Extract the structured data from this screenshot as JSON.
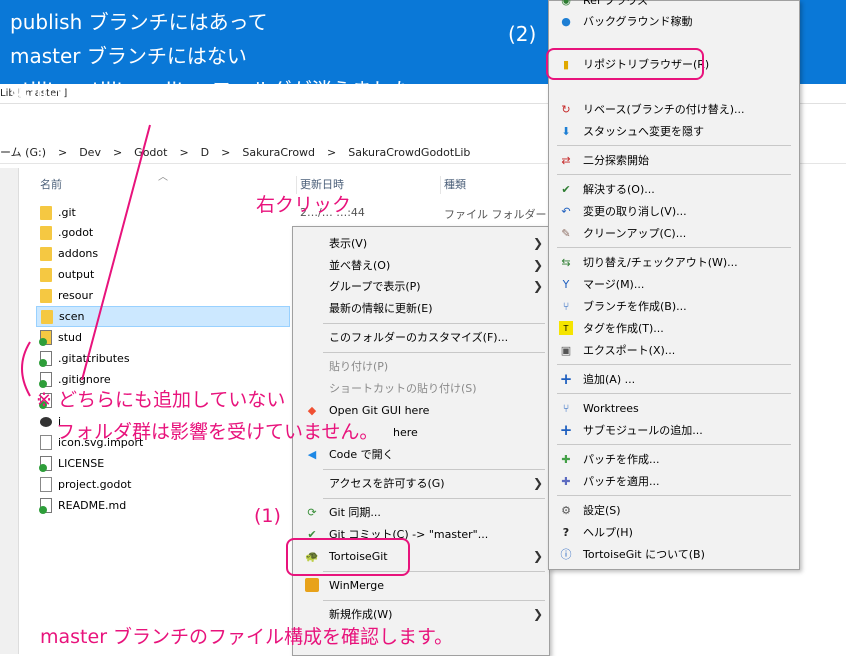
{
  "annotations": {
    "top_line1": "publish ブランチにはあって",
    "top_line2": "master ブランチにはない",
    "top_line3": "utility, utility_editor フォルダが消えました。",
    "step2": "(2)",
    "step1": "(1)",
    "right_click": "右クリック",
    "note_line1": "※ どちらにも追加していない",
    "note_line2": "フォルダ群は影響を受けていません。",
    "bottom": "master ブランチのファイル構成を確認します。"
  },
  "explorer": {
    "window_title": "Lib [ master ]",
    "breadcrumb": [
      "ーム (G:)",
      ">",
      "Dev",
      ">",
      "Godot",
      ">",
      "D",
      ">",
      "SakuraCrowd",
      ">",
      "SakuraCrowdGodotLib"
    ],
    "columns": {
      "name": "名前",
      "date": "更新日時",
      "type": "種類"
    },
    "first_row_date": "2…/… …:44",
    "first_row_type": "ファイル フォルダー",
    "items": [
      {
        "name": ".git",
        "icon": "folder-icon"
      },
      {
        "name": ".godot",
        "icon": "folder-icon"
      },
      {
        "name": "addons",
        "icon": "folder-icon"
      },
      {
        "name": "output",
        "icon": "folder-icon"
      },
      {
        "name": "resour",
        "icon": "folder-icon"
      },
      {
        "name": "scen",
        "icon": "folder-icon"
      },
      {
        "name": "stud",
        "icon": "git-folder-icon"
      },
      {
        "name": ".gitattributes",
        "icon": "git-file-icon"
      },
      {
        "name": ".gitignore",
        "icon": "git-file-icon"
      },
      {
        "name": "",
        "icon": "git-file-icon"
      },
      {
        "name": "i",
        "icon": "godot-icon"
      },
      {
        "name": "icon.svg.import",
        "icon": "file-icon"
      },
      {
        "name": "LICENSE",
        "icon": "git-file-icon"
      },
      {
        "name": "project.godot",
        "icon": "file-icon"
      },
      {
        "name": "README.md",
        "icon": "git-file-icon"
      }
    ]
  },
  "context_menu": {
    "items": [
      {
        "label": "表示(V)",
        "submenu": true
      },
      {
        "label": "並べ替え(O)",
        "submenu": true
      },
      {
        "label": "グループで表示(P)",
        "submenu": true
      },
      {
        "label": "最新の情報に更新(E)"
      },
      {
        "label": "このフォルダーのカスタマイズ(F)..."
      },
      {
        "label": "貼り付け(P)",
        "disabled": true
      },
      {
        "label": "ショートカットの貼り付け(S)",
        "disabled": true
      },
      {
        "label": "Open Git GUI here"
      },
      {
        "label": "here"
      },
      {
        "label": "Code で開く"
      },
      {
        "label": "アクセスを許可する(G)",
        "submenu": true
      },
      {
        "label": "Git 同期..."
      },
      {
        "label": "Git コミット(C) -> \"master\"..."
      },
      {
        "label": "TortoiseGit",
        "submenu": true
      },
      {
        "label": "WinMerge"
      },
      {
        "label": "新規作成(W)",
        "submenu": true
      }
    ]
  },
  "tortoise_menu": {
    "items": [
      {
        "label": "Ref ブラウズ",
        "icon": "ref-icon"
      },
      {
        "label": "バックグラウンド稼動",
        "icon": "globe-icon"
      },
      {
        "label": "リポジトリブラウザー(R)",
        "icon": "repo-browser-icon"
      },
      {
        "label": "リベース(ブランチの付け替え)...",
        "icon": "rebase-icon"
      },
      {
        "label": "スタッシュへ変更を隠す",
        "icon": "stash-icon"
      },
      {
        "label": "二分探索開始",
        "icon": "bisect-icon"
      },
      {
        "label": "解決する(O)...",
        "icon": "resolve-icon"
      },
      {
        "label": "変更の取り消し(V)...",
        "icon": "revert-icon"
      },
      {
        "label": "クリーンアップ(C)...",
        "icon": "cleanup-icon"
      },
      {
        "label": "切り替え/チェックアウト(W)...",
        "icon": "checkout-icon"
      },
      {
        "label": "マージ(M)...",
        "icon": "merge-icon"
      },
      {
        "label": "ブランチを作成(B)...",
        "icon": "branch-icon"
      },
      {
        "label": "タグを作成(T)...",
        "icon": "tag-icon"
      },
      {
        "label": "エクスポート(X)...",
        "icon": "export-icon"
      },
      {
        "label": "追加(A) ...",
        "icon": "add-icon"
      },
      {
        "label": "Worktrees",
        "icon": "worktree-icon"
      },
      {
        "label": "サブモジュールの追加...",
        "icon": "submodule-add-icon"
      },
      {
        "label": "パッチを作成...",
        "icon": "patch-create-icon"
      },
      {
        "label": "パッチを適用...",
        "icon": "patch-apply-icon"
      },
      {
        "label": "設定(S)",
        "icon": "settings-icon"
      },
      {
        "label": "ヘルプ(H)",
        "icon": "help-icon"
      },
      {
        "label": "TortoiseGit について(B)",
        "icon": "about-icon"
      }
    ]
  },
  "colors": {
    "accent_blue": "#0a78d7",
    "annotation_pink": "#e8137c"
  }
}
